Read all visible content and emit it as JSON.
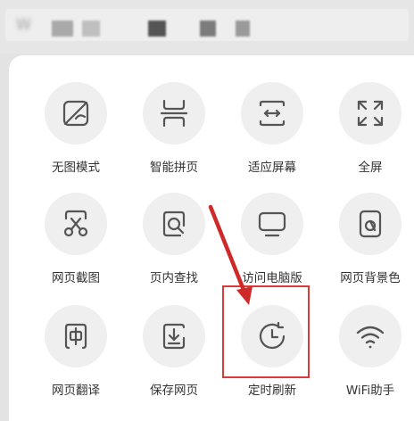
{
  "header": {
    "address_text": "W"
  },
  "menu": {
    "items": [
      {
        "label": "无图模式",
        "icon": "no-image-icon"
      },
      {
        "label": "智能拼页",
        "icon": "smart-page-join-icon"
      },
      {
        "label": "适应屏幕",
        "icon": "fit-screen-icon"
      },
      {
        "label": "全屏",
        "icon": "fullscreen-icon"
      },
      {
        "label": "网页截图",
        "icon": "scissors-icon"
      },
      {
        "label": "页内查找",
        "icon": "find-in-page-icon"
      },
      {
        "label": "访问电脑版",
        "icon": "desktop-icon"
      },
      {
        "label": "网页背景色",
        "icon": "background-color-icon"
      },
      {
        "label": "网页翻译",
        "icon": "translate-icon"
      },
      {
        "label": "保存网页",
        "icon": "save-page-icon"
      },
      {
        "label": "定时刷新",
        "icon": "timed-refresh-icon"
      },
      {
        "label": "WiFi助手",
        "icon": "wifi-icon"
      }
    ]
  },
  "colors": {
    "icon": "#555555",
    "highlight": "#d93a3a",
    "circle": "#efefef"
  }
}
